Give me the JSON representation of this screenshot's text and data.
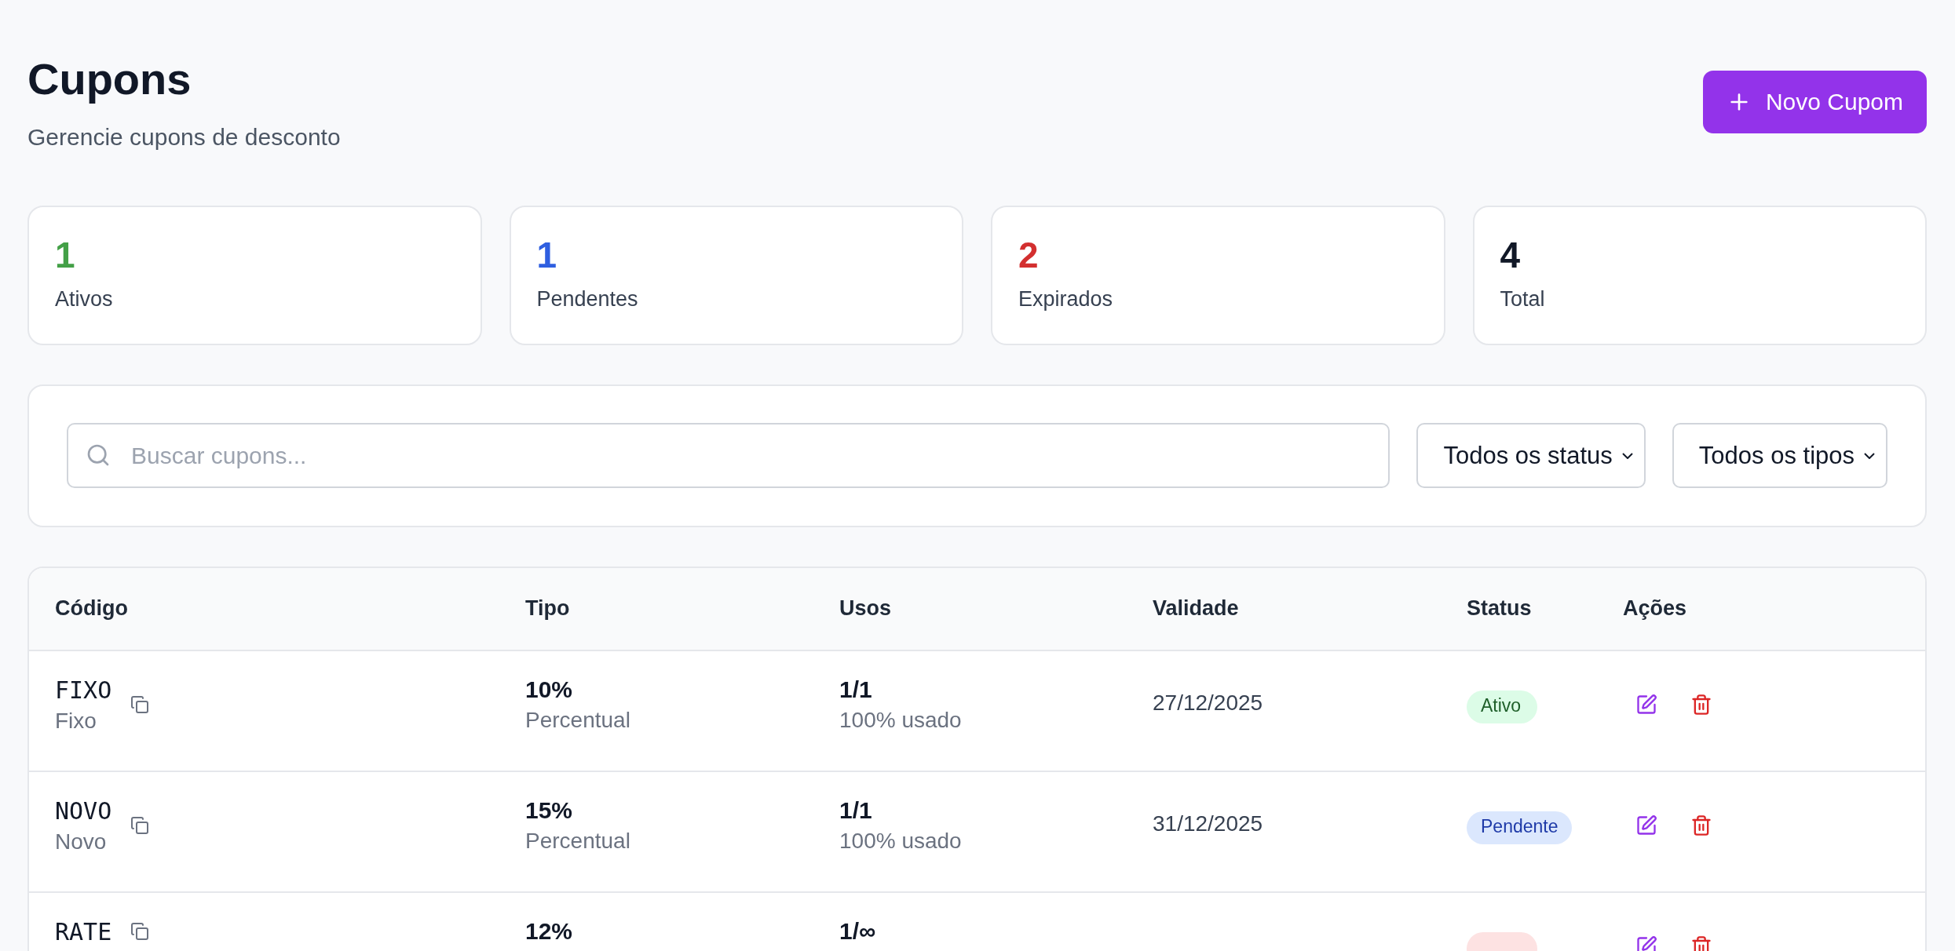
{
  "page": {
    "title": "Cupons",
    "subtitle": "Gerencie cupons de desconto",
    "new_button": "Novo Cupom"
  },
  "stats": [
    {
      "value": "1",
      "label": "Ativos",
      "color": "#43a047"
    },
    {
      "value": "1",
      "label": "Pendentes",
      "color": "#2f5fe0"
    },
    {
      "value": "2",
      "label": "Expirados",
      "color": "#d32f2f"
    },
    {
      "value": "4",
      "label": "Total",
      "color": "#111827"
    }
  ],
  "filters": {
    "search": {
      "placeholder": "Buscar cupons..."
    },
    "selects": [
      "Todos os status",
      "Todos os tipos"
    ]
  },
  "table": {
    "columns": [
      "Código",
      "Tipo",
      "Usos",
      "Validade",
      "Status",
      "Ações"
    ],
    "rows": [
      {
        "code": "FIXO",
        "name": "Fixo",
        "value": "10%",
        "type": "Percentual",
        "uses": "1/1",
        "usage": "100% usado",
        "validity": "27/12/2025",
        "status": {
          "kind": "active",
          "label": "Ativo"
        }
      },
      {
        "code": "NOVO",
        "name": "Novo",
        "value": "15%",
        "type": "Percentual",
        "uses": "1/1",
        "usage": "100% usado",
        "validity": "31/12/2025",
        "status": {
          "kind": "pending",
          "label": "Pendente"
        }
      },
      {
        "code": "RATE",
        "value": "12%",
        "uses": "1/∞",
        "status": {
          "kind": "expired"
        }
      }
    ]
  }
}
